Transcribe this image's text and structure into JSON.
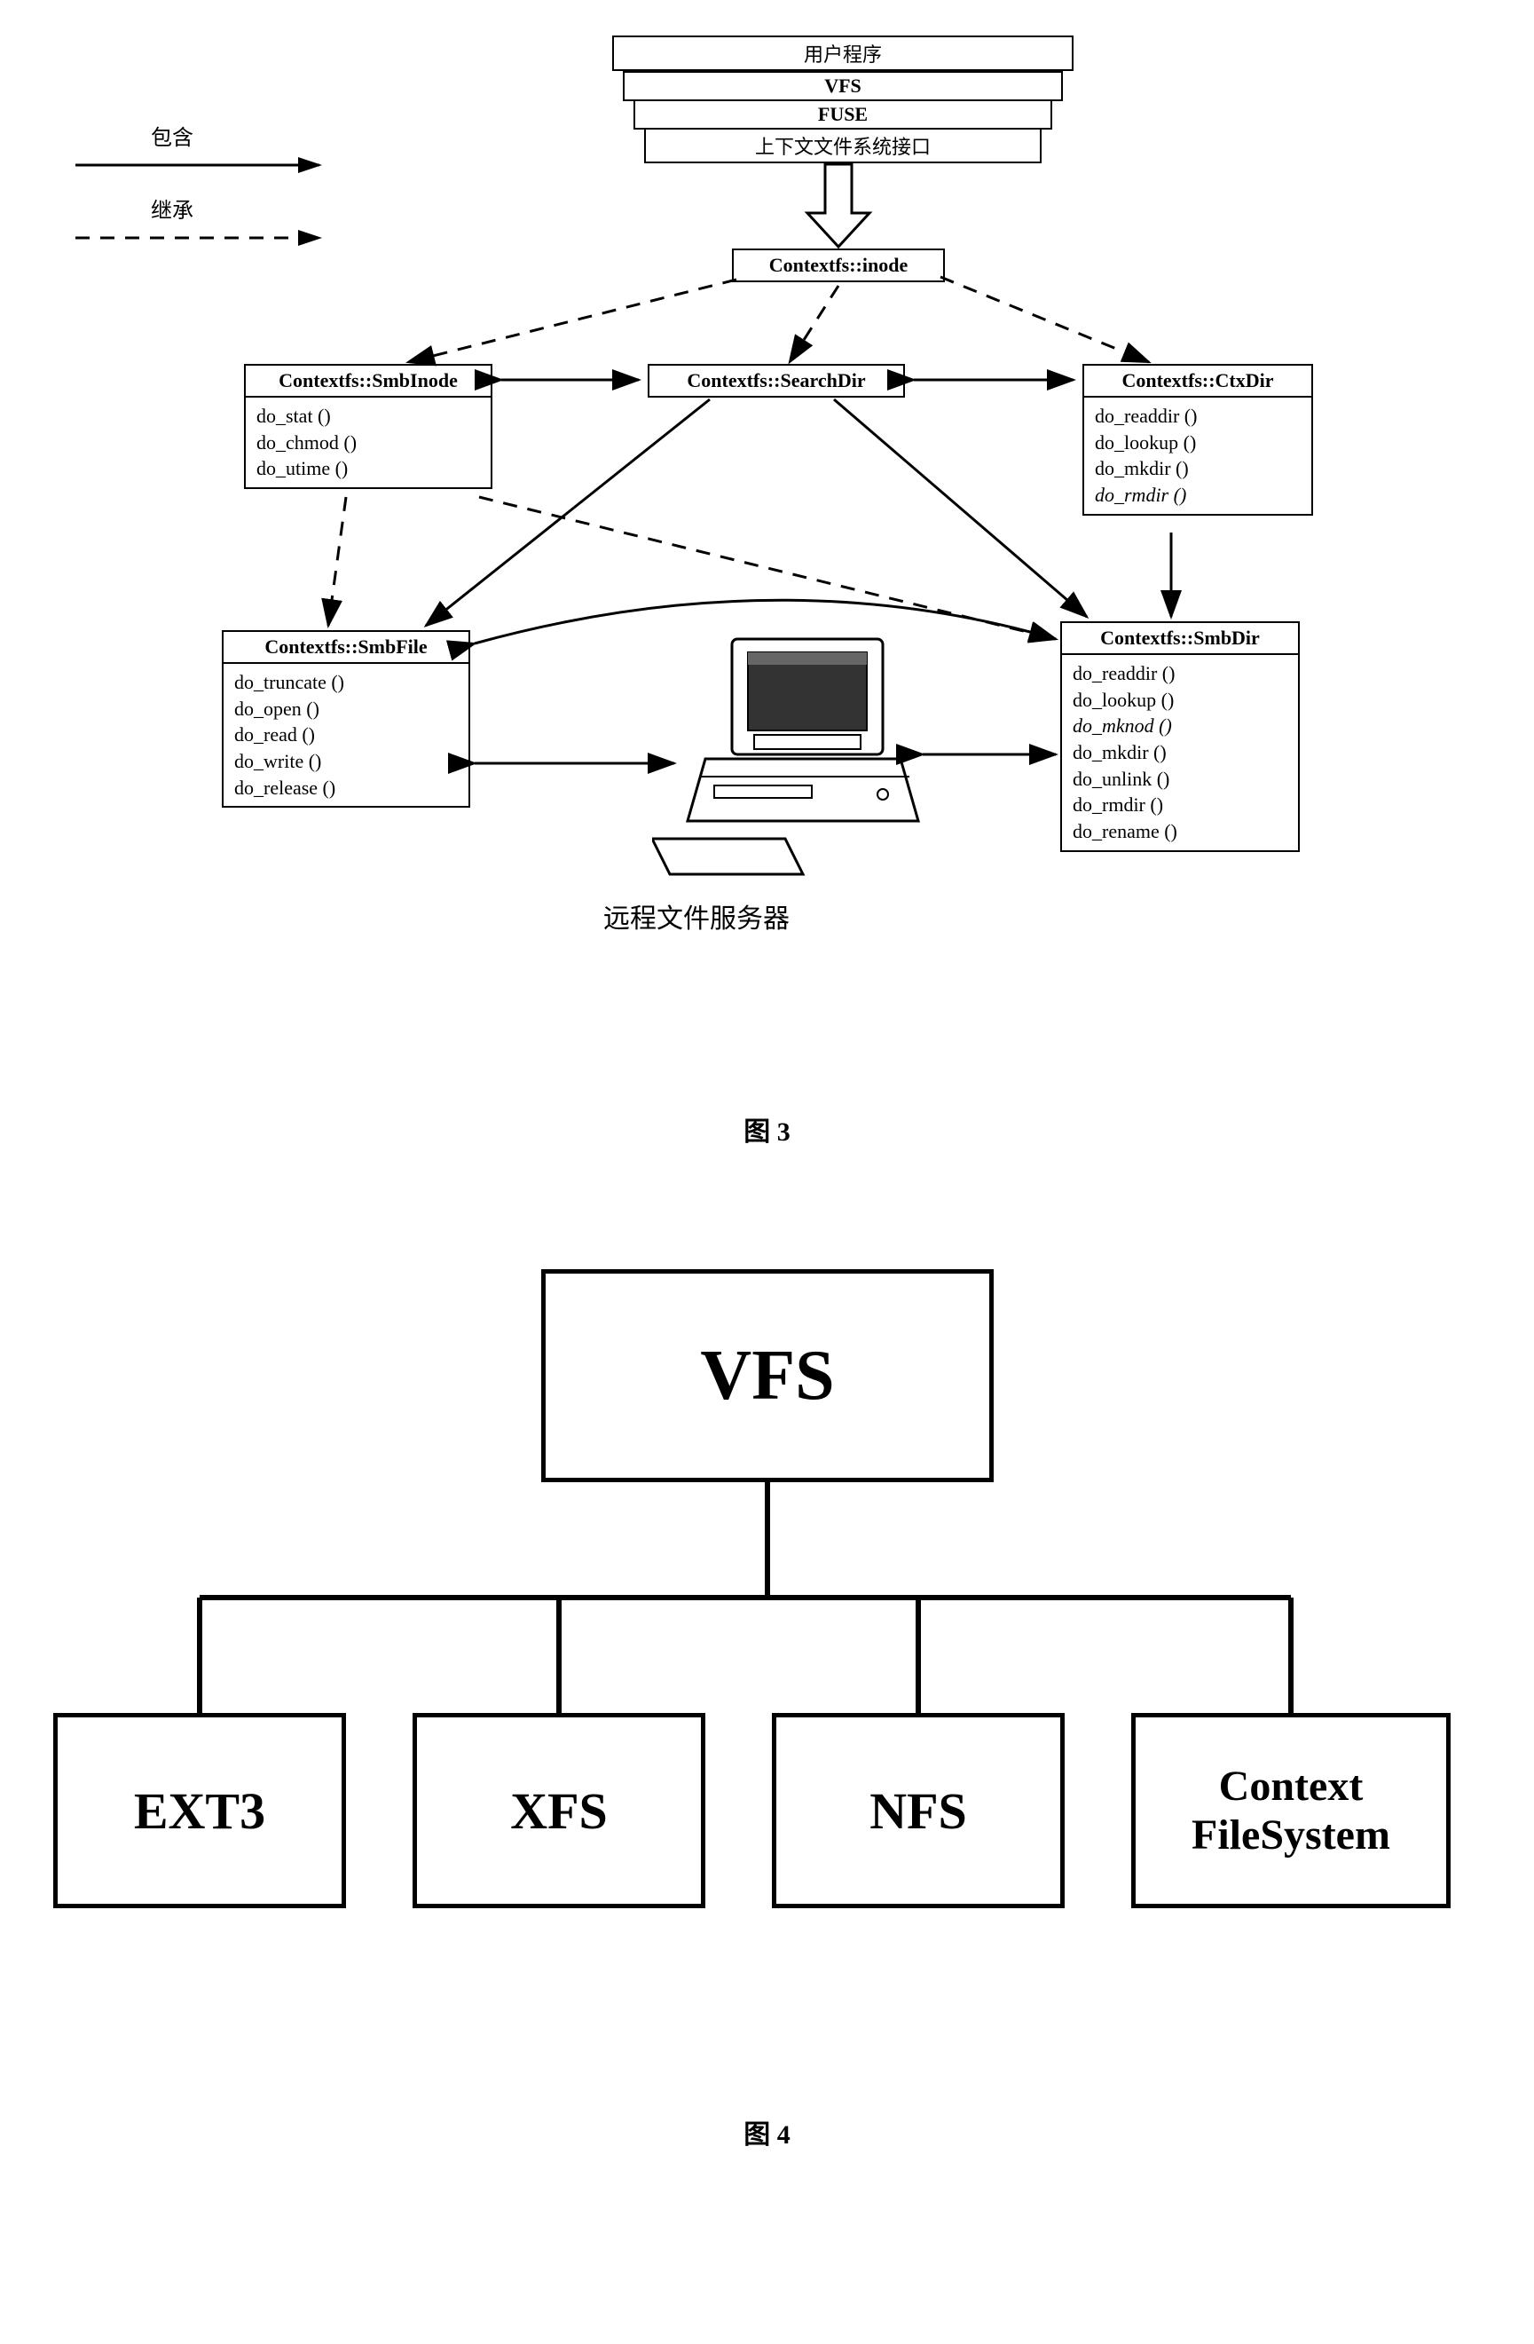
{
  "figure3": {
    "legend": {
      "contains": "包含",
      "inherits": "继承"
    },
    "stack": {
      "layer1": "用户程序",
      "layer2": "VFS",
      "layer3": "FUSE",
      "layer4": "上下文文件系统接口"
    },
    "inode": {
      "title": "Contextfs::inode"
    },
    "smbInode": {
      "title": "Contextfs::SmbInode",
      "m1": "do_stat ()",
      "m2": "do_chmod ()",
      "m3": "do_utime ()"
    },
    "searchDir": {
      "title": "Contextfs::SearchDir"
    },
    "ctxDir": {
      "title": "Contextfs::CtxDir",
      "m1": "do_readdir ()",
      "m2": "do_lookup ()",
      "m3": "do_mkdir ()",
      "m4": "do_rmdir ()"
    },
    "smbFile": {
      "title": "Contextfs::SmbFile",
      "m1": "do_truncate ()",
      "m2": "do_open ()",
      "m3": "do_read ()",
      "m4": "do_write ()",
      "m5": "do_release ()"
    },
    "smbDir": {
      "title": "Contextfs::SmbDir",
      "m1": "do_readdir ()",
      "m2": "do_lookup ()",
      "m3": "do_mknod ()",
      "m4": "do_mkdir ()",
      "m5": "do_unlink ()",
      "m6": "do_rmdir ()",
      "m7": "do_rename ()"
    },
    "server_label": "远程文件服务器",
    "caption": "图 3"
  },
  "figure4": {
    "vfs": "VFS",
    "ext3": "EXT3",
    "xfs": "XFS",
    "nfs": "NFS",
    "ctxfs_l1": "Context",
    "ctxfs_l2": "FileSystem",
    "caption": "图 4"
  }
}
